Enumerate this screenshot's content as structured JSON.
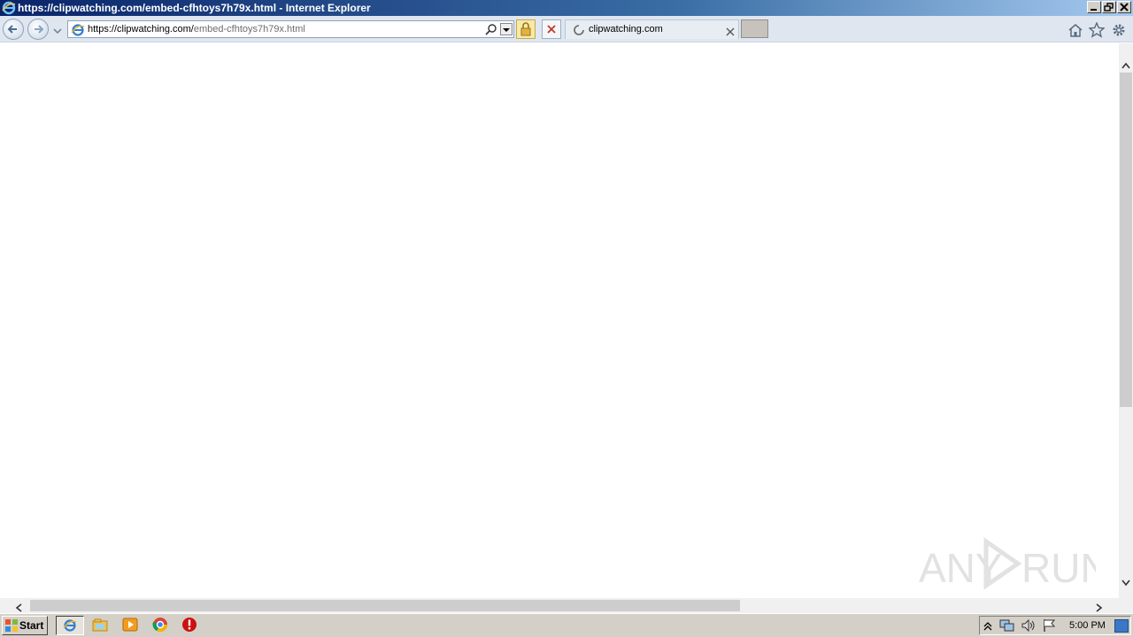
{
  "window": {
    "title": "https://clipwatching.com/embed-cfhtoys7h79x.html - Internet Explorer"
  },
  "nav": {
    "url_host": "https://clipwatching.com/",
    "url_path": "embed-cfhtoys7h79x.html",
    "tab_title": "clipwatching.com"
  },
  "watermark": {
    "text_left": "ANY",
    "text_right": "RUN"
  },
  "taskbar": {
    "start_label": "Start",
    "clock": "5:00 PM"
  }
}
